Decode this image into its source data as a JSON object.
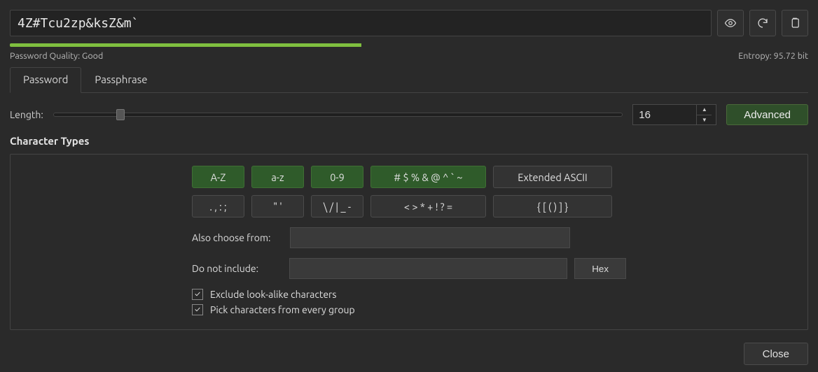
{
  "password_value": "4Z#Tcu2zp&ksZ&m`",
  "quality_label": "Password Quality: Good",
  "entropy_label": "Entropy: 95.72 bit",
  "tabs": {
    "password": "Password",
    "passphrase": "Passphrase"
  },
  "length_label": "Length:",
  "length_value": "16",
  "advanced_label": "Advanced",
  "section_title": "Character Types",
  "char_groups": {
    "upper": "A-Z",
    "lower": "a-z",
    "digits": "0-9",
    "specials": "# $ % & @ ^ ` ~",
    "ext_ascii": "Extended ASCII",
    "punct": ". , : ;",
    "quotes": "\" '",
    "slashes": "\\ / | _ -",
    "math": "< > * + ! ? =",
    "braces": "{ [ ( ) ] }"
  },
  "also_choose_label": "Also choose from:",
  "also_choose_value": "",
  "exclude_label": "Do not include:",
  "exclude_value": "",
  "hex_label": "Hex",
  "check_exclude_lookalike": "Exclude look-alike characters",
  "check_every_group": "Pick characters from every group",
  "close_label": "Close"
}
